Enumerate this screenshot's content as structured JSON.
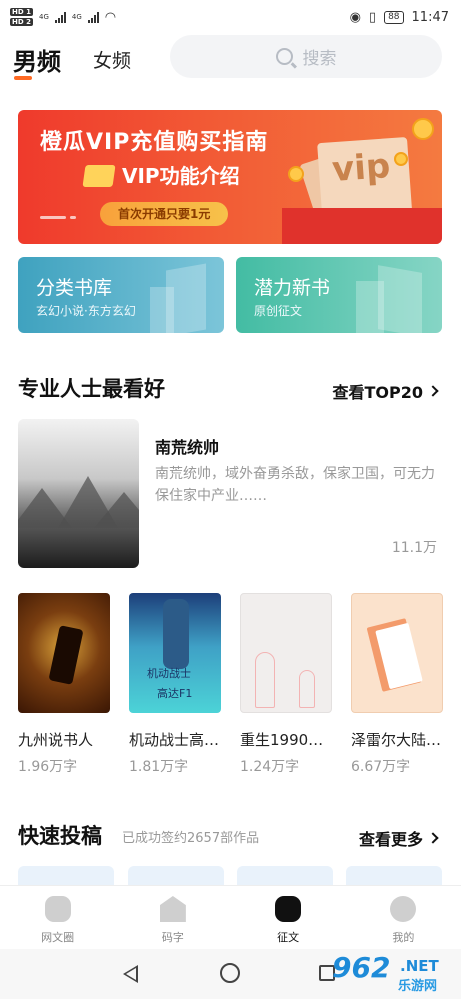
{
  "status_bar": {
    "left": [
      "HD 1",
      "HD 2"
    ],
    "net": [
      "4G",
      "4G"
    ],
    "battery": "88",
    "time": "11:47"
  },
  "header": {
    "tab_male": "男频",
    "tab_female": "女频",
    "search_placeholder": "搜索"
  },
  "banner": {
    "title": "橙瓜VIP充值购买指南",
    "subtitle": "VIP功能介绍",
    "pill": "首次开通只要1元",
    "vip_text": "vip"
  },
  "categories": [
    {
      "title": "分类书库",
      "subtitle": "玄幻小说·东方玄幻"
    },
    {
      "title": "潜力新书",
      "subtitle": "原创征文"
    }
  ],
  "section_top": {
    "title": "专业人士最看好",
    "link": "查看TOP20"
  },
  "featured": {
    "title": "南荒统帅",
    "desc": "南荒统帅，域外奋勇杀敌，保家卫国，可无力保住家中产业……",
    "count": "11.1万"
  },
  "books": [
    {
      "name": "九州说书人",
      "count": "1.96万字"
    },
    {
      "name": "机动战士高…",
      "count": "1.81万字",
      "cover_text": [
        "机动战士",
        "高达F1"
      ]
    },
    {
      "name": "重生1990…",
      "count": "1.24万字"
    },
    {
      "name": "泽雷尔大陆…",
      "count": "6.67万字"
    }
  ],
  "section_submit": {
    "title": "快速投稿",
    "note": "已成功签约2657部作品",
    "link": "查看更多"
  },
  "tabbar": [
    {
      "label": "网文圈",
      "icon": "chat-bubble-icon"
    },
    {
      "label": "码字",
      "icon": "house-icon"
    },
    {
      "label": "征文",
      "icon": "submission-icon",
      "active": true
    },
    {
      "label": "我的",
      "icon": "profile-icon"
    }
  ],
  "watermark": {
    "num": "962",
    "net": ".NET",
    "site": "乐游网"
  },
  "colors": {
    "accent": "#ff6a24",
    "banner_red": "#ef3a2c",
    "teal": "#3fa2bf",
    "green": "#43bca3"
  }
}
